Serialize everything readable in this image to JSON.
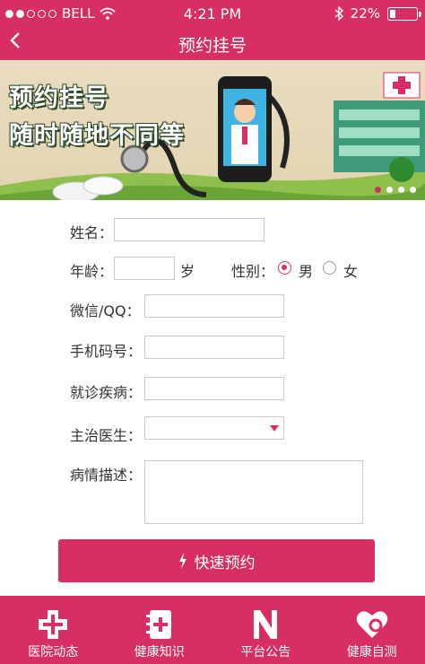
{
  "status": {
    "carrier": "BELL",
    "time": "4:21 PM",
    "battery": "22%",
    "battery_level": 0.22
  },
  "nav": {
    "back_icon": "chevron-left-icon",
    "title": "预约挂号"
  },
  "banner": {
    "line1": "预约挂号",
    "line2": "随时随地不同等",
    "pages": 4,
    "active_page": 1
  },
  "form": {
    "name_label": "姓名：",
    "age_label": "年龄：",
    "age_unit": "岁",
    "gender_label": "性别：",
    "gender_options": [
      "男",
      "女"
    ],
    "gender_selected": "男",
    "wechat_label": "微信/QQ：",
    "phone_label": "手机码号：",
    "disease_label": "就诊疾病：",
    "doctor_label": "主治医生：",
    "desc_label": "病情描述：",
    "submit_label": "快速预约"
  },
  "tabs": [
    {
      "label": "医院动态",
      "icon": "hospital-cross-icon"
    },
    {
      "label": "健康知识",
      "icon": "health-book-icon"
    },
    {
      "label": "平台公告",
      "icon": "announcement-n-icon"
    },
    {
      "label": "健康自测",
      "icon": "heart-search-icon"
    }
  ],
  "colors": {
    "accent": "#d72f63"
  }
}
